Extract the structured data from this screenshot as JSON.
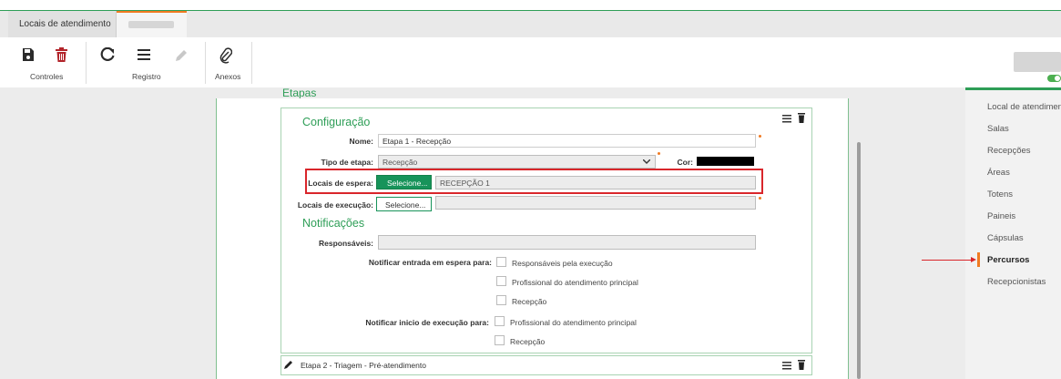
{
  "tabs": [
    {
      "label": "Locais de atendimento",
      "active": false
    },
    {
      "label": "",
      "active": true
    }
  ],
  "toolbar": {
    "groups": [
      {
        "label": "Controles",
        "icons": [
          "save-icon",
          "trash-icon"
        ]
      },
      {
        "label": "Registro",
        "icons": [
          "refresh-icon",
          "menu-icon",
          "pencil-icon"
        ]
      },
      {
        "label": "Anexos",
        "icons": [
          "paperclip-icon"
        ]
      }
    ]
  },
  "partial_header": "Etapas",
  "etapa1": {
    "section_config": "Configuração",
    "nome_label": "Nome:",
    "nome_value": "Etapa 1 - Recepção",
    "tipo_label": "Tipo de etapa:",
    "tipo_value": "Recepção",
    "cor_label": "Cor:",
    "cor_value": "#000000",
    "locais_espera_label": "Locais de espera:",
    "locais_espera_button": "Selecione...",
    "locais_espera_value": "RECEPÇÃO 1",
    "locais_execucao_label": "Locais de execução:",
    "locais_execucao_button": "Selecione...",
    "locais_execucao_value": "",
    "section_notif": "Notificações",
    "responsaveis_label": "Responsáveis:",
    "notif_espera_label": "Notificar entrada em espera para:",
    "notif_espera_options": [
      "Responsáveis pela execução",
      "Profissional do atendimento principal",
      "Recepção"
    ],
    "notif_execucao_label": "Notificar inicio de execução para:",
    "notif_execucao_options": [
      "Profissional do atendimento principal",
      "Recepção"
    ]
  },
  "etapa2": {
    "title": "Etapa 2 - Triagem - Pré-atendimento"
  },
  "right_panel": {
    "items": [
      "Local de atendimen",
      "Salas",
      "Recepções",
      "Áreas",
      "Totens",
      "Paineis",
      "Cápsulas",
      "Percursos",
      "Recepcionistas"
    ],
    "active": "Percursos"
  },
  "colors": {
    "accent": "#2e9e57",
    "tab_highlight": "#f07b22",
    "annotation": "#d9262b",
    "button": "#17935a"
  }
}
